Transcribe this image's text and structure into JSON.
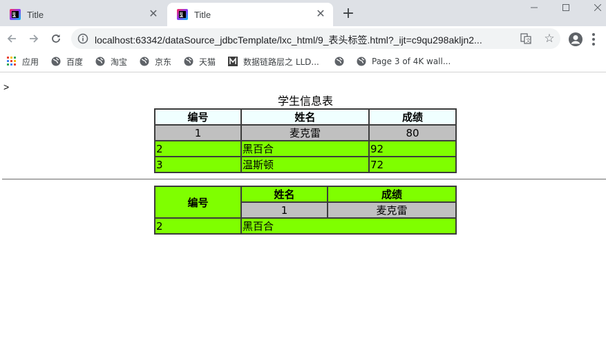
{
  "browser": {
    "tabs": [
      {
        "title": "Title",
        "active": false,
        "icon": "jetbrains-icon"
      },
      {
        "title": "Title",
        "active": true,
        "icon": "jetbrains-icon"
      }
    ],
    "url": "localhost:63342/dataSource_jdbcTemplate/lxc_html/9_表头标签.html?_ijt=c9qu298akljn2...",
    "bookmarks": [
      {
        "label": "应用",
        "icon": "apps-grid-icon"
      },
      {
        "label": "百度",
        "icon": "globe-icon"
      },
      {
        "label": "淘宝",
        "icon": "globe-icon"
      },
      {
        "label": "京东",
        "icon": "globe-icon"
      },
      {
        "label": "天猫",
        "icon": "globe-icon"
      },
      {
        "label": "数据链路层之 LLD...",
        "icon": "m-logo-icon"
      },
      {
        "label": "",
        "icon": "globe-icon"
      },
      {
        "label": "Page 3 of 4K wall...",
        "icon": "globe-icon"
      }
    ]
  },
  "page": {
    "stray_text": ">",
    "table1": {
      "caption": "学生信息表",
      "headers": [
        "编号",
        "姓名",
        "成绩"
      ],
      "rows": [
        {
          "cells": [
            "1",
            "麦克雷",
            "80"
          ],
          "style": "gray"
        },
        {
          "cells": [
            "2",
            "黑百合",
            "92"
          ],
          "style": "green"
        },
        {
          "cells": [
            "3",
            "温斯顿",
            "72"
          ],
          "style": "green"
        }
      ]
    },
    "table2": {
      "header_rowspan": "编号",
      "header_cols": [
        "姓名",
        "成绩"
      ],
      "sub_row": [
        "1",
        "麦克雷"
      ],
      "row": [
        "2",
        "黑百合"
      ]
    }
  },
  "colors": {
    "header_bg": "#f0ffff",
    "gray_row_bg": "#c0c0c0",
    "green_row_bg": "#7fff00"
  }
}
